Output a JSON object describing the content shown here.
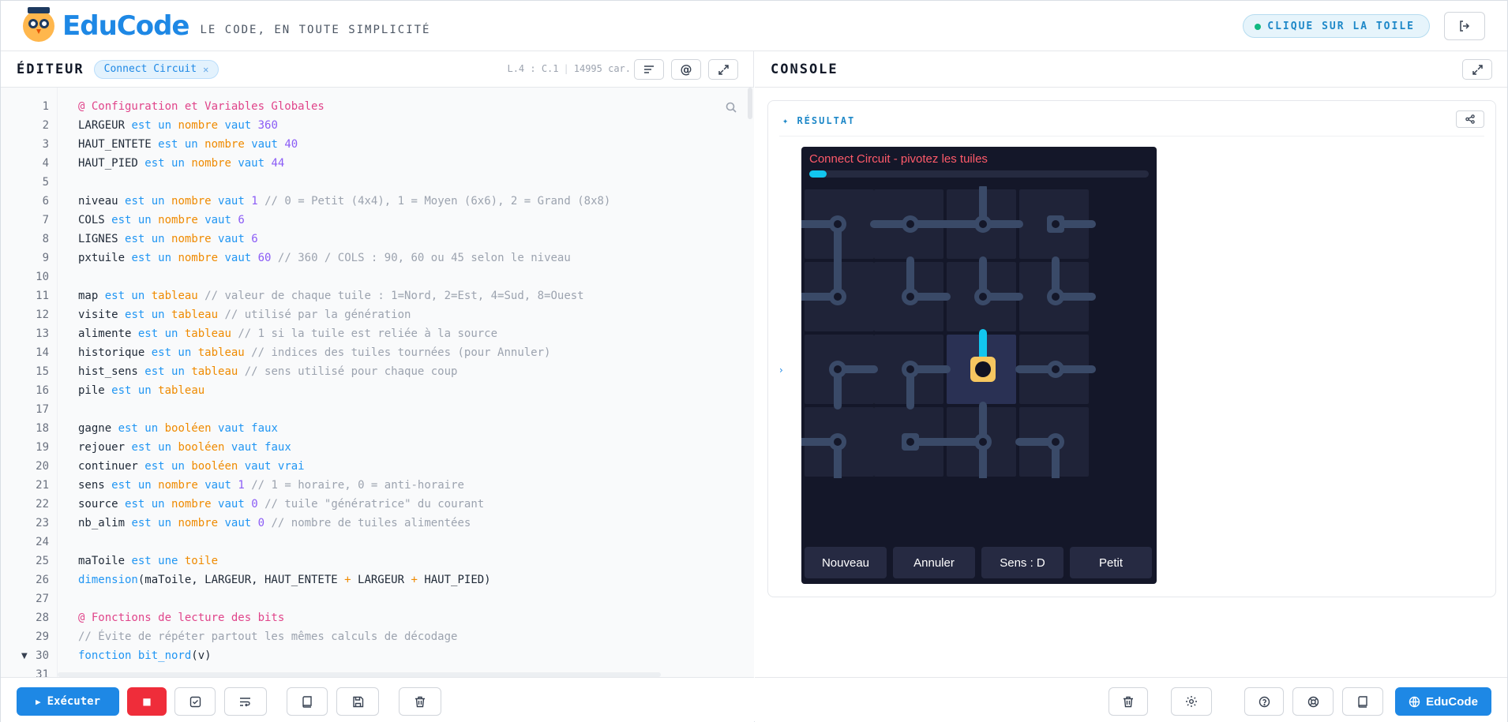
{
  "header": {
    "brand": "EduCode",
    "tagline": "LE CODE, EN TOUTE SIMPLICITÉ",
    "hint": "CLIQUE SUR LA TOILE"
  },
  "editor": {
    "title": "ÉDITEUR",
    "file_tab": "Connect Circuit",
    "cursor_pos": "L.4 : C.1",
    "char_count": "14995 car.",
    "line_numbers": [
      "1",
      "2",
      "3",
      "4",
      "5",
      "6",
      "7",
      "8",
      "9",
      "10",
      "11",
      "12",
      "13",
      "14",
      "15",
      "16",
      "17",
      "18",
      "19",
      "20",
      "21",
      "22",
      "23",
      "24",
      "25",
      "26",
      "27",
      "28",
      "29",
      "30",
      "31"
    ],
    "run_label": "Exécuter"
  },
  "code": [
    [
      [
        "sec",
        "@ Configuration et Variables Globales"
      ]
    ],
    [
      [
        "",
        "LARGEUR "
      ],
      [
        "k",
        "est un "
      ],
      [
        "t",
        "nombre "
      ],
      [
        "k",
        "vaut "
      ],
      [
        "n",
        "360"
      ]
    ],
    [
      [
        "",
        "HAUT_ENTETE "
      ],
      [
        "k",
        "est un "
      ],
      [
        "t",
        "nombre "
      ],
      [
        "k",
        "vaut "
      ],
      [
        "n",
        "40"
      ]
    ],
    [
      [
        "",
        "HAUT_PIED "
      ],
      [
        "k",
        "est un "
      ],
      [
        "t",
        "nombre "
      ],
      [
        "k",
        "vaut "
      ],
      [
        "n",
        "44"
      ]
    ],
    [],
    [
      [
        "",
        "niveau "
      ],
      [
        "k",
        "est un "
      ],
      [
        "t",
        "nombre "
      ],
      [
        "k",
        "vaut "
      ],
      [
        "n",
        "1 "
      ],
      [
        "c",
        "// 0 = Petit (4x4), 1 = Moyen (6x6), 2 = Grand (8x8)"
      ]
    ],
    [
      [
        "",
        "COLS "
      ],
      [
        "k",
        "est un "
      ],
      [
        "t",
        "nombre "
      ],
      [
        "k",
        "vaut "
      ],
      [
        "n",
        "6"
      ]
    ],
    [
      [
        "",
        "LIGNES "
      ],
      [
        "k",
        "est un "
      ],
      [
        "t",
        "nombre "
      ],
      [
        "k",
        "vaut "
      ],
      [
        "n",
        "6"
      ]
    ],
    [
      [
        "",
        "pxtuile "
      ],
      [
        "k",
        "est un "
      ],
      [
        "t",
        "nombre "
      ],
      [
        "k",
        "vaut "
      ],
      [
        "n",
        "60 "
      ],
      [
        "c",
        "// 360 / COLS : 90, 60 ou 45 selon le niveau"
      ]
    ],
    [],
    [
      [
        "",
        "map "
      ],
      [
        "k",
        "est un "
      ],
      [
        "t",
        "tableau "
      ],
      [
        "c",
        "// valeur de chaque tuile : 1=Nord, 2=Est, 4=Sud, 8=Ouest"
      ]
    ],
    [
      [
        "",
        "visite "
      ],
      [
        "k",
        "est un "
      ],
      [
        "t",
        "tableau "
      ],
      [
        "c",
        "// utilisé par la génération"
      ]
    ],
    [
      [
        "",
        "alimente "
      ],
      [
        "k",
        "est un "
      ],
      [
        "t",
        "tableau "
      ],
      [
        "c",
        "// 1 si la tuile est reliée à la source"
      ]
    ],
    [
      [
        "",
        "historique "
      ],
      [
        "k",
        "est un "
      ],
      [
        "t",
        "tableau "
      ],
      [
        "c",
        "// indices des tuiles tournées (pour Annuler)"
      ]
    ],
    [
      [
        "",
        "hist_sens "
      ],
      [
        "k",
        "est un "
      ],
      [
        "t",
        "tableau "
      ],
      [
        "c",
        "// sens utilisé pour chaque coup"
      ]
    ],
    [
      [
        "",
        "pile "
      ],
      [
        "k",
        "est un "
      ],
      [
        "t",
        "tableau"
      ]
    ],
    [],
    [
      [
        "",
        "gagne "
      ],
      [
        "k",
        "est un "
      ],
      [
        "t",
        "booléen "
      ],
      [
        "k",
        "vaut faux"
      ]
    ],
    [
      [
        "",
        "rejouer "
      ],
      [
        "k",
        "est un "
      ],
      [
        "t",
        "booléen "
      ],
      [
        "k",
        "vaut faux"
      ]
    ],
    [
      [
        "",
        "continuer "
      ],
      [
        "k",
        "est un "
      ],
      [
        "t",
        "booléen "
      ],
      [
        "k",
        "vaut vrai"
      ]
    ],
    [
      [
        "",
        "sens "
      ],
      [
        "k",
        "est un "
      ],
      [
        "t",
        "nombre "
      ],
      [
        "k",
        "vaut "
      ],
      [
        "n",
        "1 "
      ],
      [
        "c",
        "// 1 = horaire, 0 = anti-horaire"
      ]
    ],
    [
      [
        "",
        "source "
      ],
      [
        "k",
        "est un "
      ],
      [
        "t",
        "nombre "
      ],
      [
        "k",
        "vaut "
      ],
      [
        "n",
        "0 "
      ],
      [
        "c",
        "// tuile \"génératrice\" du courant"
      ]
    ],
    [
      [
        "",
        "nb_alim "
      ],
      [
        "k",
        "est un "
      ],
      [
        "t",
        "nombre "
      ],
      [
        "k",
        "vaut "
      ],
      [
        "n",
        "0 "
      ],
      [
        "c",
        "// nombre de tuiles alimentées"
      ]
    ],
    [],
    [
      [
        "",
        "maToile "
      ],
      [
        "k",
        "est une "
      ],
      [
        "t",
        "toile"
      ]
    ],
    [
      [
        "f",
        "dimension"
      ],
      [
        "",
        "(maToile, LARGEUR, HAUT_ENTETE "
      ],
      [
        "t",
        "+ "
      ],
      [
        "",
        "LARGEUR "
      ],
      [
        "t",
        "+ "
      ],
      [
        "",
        "HAUT_PIED)"
      ]
    ],
    [],
    [
      [
        "sec",
        "@ Fonctions de lecture des bits"
      ]
    ],
    [
      [
        "c",
        "// Évite de répéter partout les mêmes calculs de décodage"
      ]
    ],
    [
      [
        "k",
        "fonction "
      ],
      [
        "f",
        "bit_nord"
      ],
      [
        "",
        "(v)"
      ]
    ]
  ],
  "console": {
    "title": "CONSOLE",
    "result_label": "RÉSULTAT",
    "game": {
      "title": "Connect Circuit - pivotez les tuiles",
      "progress": 0.05,
      "grid_rows": 4,
      "grid_cols": 4,
      "buttons": [
        "Nouveau",
        "Annuler",
        "Sens : D",
        "Petit"
      ]
    },
    "educode_label": "EduCode"
  },
  "colors": {
    "accent": "#1e88e5",
    "stop": "#ef2d3a",
    "game_bg": "#141729",
    "tile": "#1f2338",
    "tile_active": "#2a3154",
    "pipe": "#3a4a68",
    "powered": "#12c6ef",
    "source": "#f6c760",
    "game_title": "#ff5a6a"
  }
}
